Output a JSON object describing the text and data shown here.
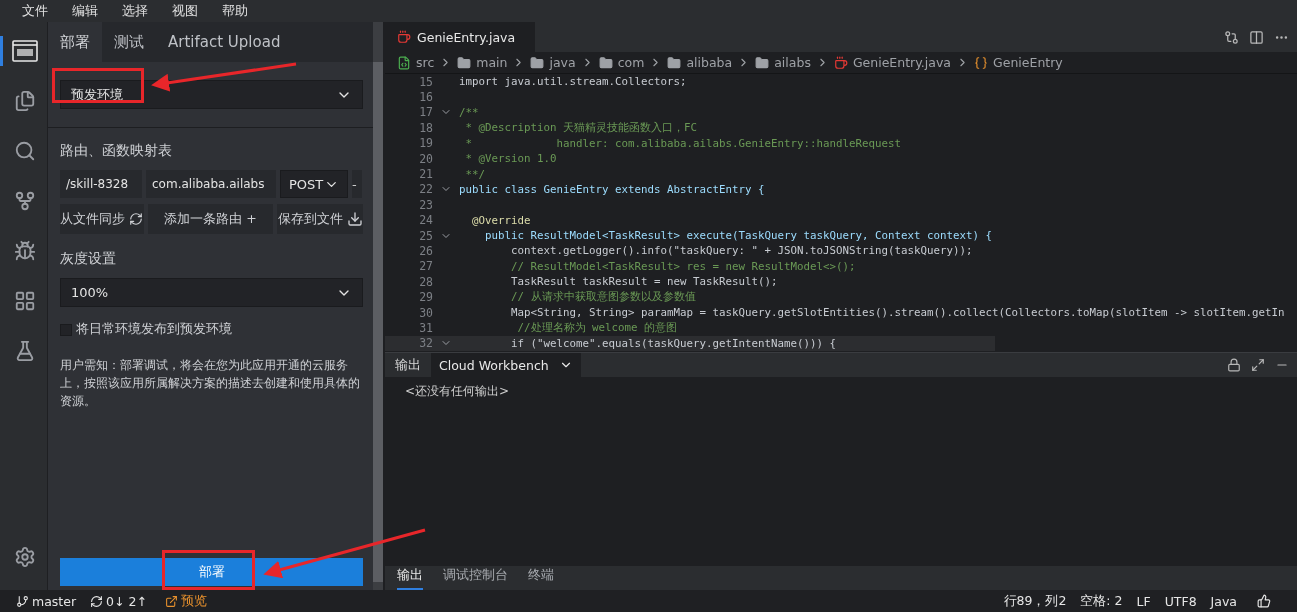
{
  "menu": [
    "文件",
    "编辑",
    "选择",
    "视图",
    "帮助"
  ],
  "activity_bar": [
    {
      "selected": true
    },
    {
      "selected": false
    },
    {
      "selected": false
    },
    {
      "selected": false
    },
    {
      "selected": false
    },
    {
      "selected": false
    },
    {
      "selected": false
    }
  ],
  "side_panel": {
    "tabs": [
      {
        "label": "部署",
        "selected": true
      },
      {
        "label": "测试",
        "selected": false
      },
      {
        "label": "Artifact Upload",
        "selected": false
      }
    ],
    "environment": {
      "value": "预发环境"
    },
    "routes": {
      "title": "路由、函数映射表",
      "path": "/skill-8328",
      "handler": "com.alibaba.ailabs",
      "method": "POST",
      "remove": "-",
      "buttons": [
        {
          "label": "从文件同步",
          "kind": "sync"
        },
        {
          "label": "添加一条路由 +",
          "kind": "plain"
        },
        {
          "label": "保存到文件",
          "kind": "download"
        }
      ]
    },
    "gray": {
      "title": "灰度设置",
      "value": "100%"
    },
    "checkbox": {
      "label": "将日常环境发布到预发环境",
      "checked": false
    },
    "notice": "用户需知：部署调试，将会在您为此应用开通的云服务上，按照该应用所属解决方案的描述去创建和使用具体的资源。",
    "deploy_button": "部署"
  },
  "editor": {
    "tab": "GenieEntry.java",
    "breadcrumbs": [
      {
        "label": "src",
        "kind": "source"
      },
      {
        "label": "main",
        "kind": "folder"
      },
      {
        "label": "java",
        "kind": "folder"
      },
      {
        "label": "com",
        "kind": "folder"
      },
      {
        "label": "alibaba",
        "kind": "folder"
      },
      {
        "label": "ailabs",
        "kind": "folder"
      },
      {
        "label": "GenieEntry.java",
        "kind": "file"
      },
      {
        "label": "GenieEntry",
        "kind": "class"
      }
    ],
    "lines": [
      {
        "number": "15",
        "foldable": false,
        "highlighted": false,
        "kind": "code",
        "text": "import java.util.stream.Collectors;"
      },
      {
        "number": "16",
        "foldable": false,
        "highlighted": false
      },
      {
        "number": "17",
        "foldable": true,
        "highlighted": false,
        "kind": "comment",
        "text": "/**"
      },
      {
        "number": "18",
        "foldable": false,
        "highlighted": false,
        "kind": "comment",
        "text": " * @Description 天猫精灵技能函数入口，FC"
      },
      {
        "number": "19",
        "foldable": false,
        "highlighted": false,
        "kind": "comment",
        "text": " *             handler: com.alibaba.ailabs.GenieEntry::handleRequest"
      },
      {
        "number": "20",
        "foldable": false,
        "highlighted": false,
        "kind": "comment",
        "text": " * @Version 1.0"
      },
      {
        "number": "21",
        "foldable": false,
        "highlighted": false,
        "kind": "comment",
        "text": " **/"
      },
      {
        "number": "22",
        "foldable": true,
        "highlighted": false,
        "kind": "declaration",
        "text": "public class GenieEntry extends AbstractEntry {"
      },
      {
        "number": "23",
        "foldable": false,
        "highlighted": false
      },
      {
        "number": "24",
        "foldable": false,
        "highlighted": false,
        "kind": "annotation",
        "text": "  @Override"
      },
      {
        "number": "25",
        "foldable": true,
        "highlighted": false,
        "kind": "declaration",
        "text": "    public ResultModel<TaskResult> execute(TaskQuery taskQuery, Context context) {"
      },
      {
        "number": "26",
        "foldable": false,
        "highlighted": false,
        "kind": "code",
        "text": "        context.getLogger().info(\"taskQuery: \" + JSON.toJSONString(taskQuery));"
      },
      {
        "number": "27",
        "foldable": false,
        "highlighted": false,
        "kind": "comment",
        "text": "        // ResultModel<TaskResult> res = new ResultModel<>();"
      },
      {
        "number": "28",
        "foldable": false,
        "highlighted": false,
        "kind": "code",
        "text": "        TaskResult taskResult = new TaskResult();"
      },
      {
        "number": "29",
        "foldable": false,
        "highlighted": false,
        "kind": "comment",
        "text": "        // 从请求中获取意图参数以及参数值"
      },
      {
        "number": "30",
        "foldable": false,
        "highlighted": false,
        "kind": "code",
        "text": "        Map<String, String> paramMap = taskQuery.getSlotEntities().stream().collect(Collectors.toMap(slotItem -> slotItem.getIn"
      },
      {
        "number": "31",
        "foldable": false,
        "highlighted": false,
        "kind": "comment",
        "text": "         //处理名称为 welcome 的意图"
      },
      {
        "number": "32",
        "foldable": true,
        "highlighted": true,
        "kind": "code",
        "text": "        if (\"welcome\".equals(taskQuery.getIntentName())) {"
      }
    ]
  },
  "output": {
    "title": "输出",
    "channel": "Cloud Workbench",
    "content": "<还没有任何输出>"
  },
  "bottom_tabs": [
    {
      "label": "输出",
      "selected": true
    },
    {
      "label": "调试控制台",
      "selected": false
    },
    {
      "label": "终端",
      "selected": false
    }
  ],
  "status_bar": {
    "branch": "master",
    "sync": "0↓ 2↑",
    "preview": "预览",
    "right": [
      "行89，列2",
      "空格: 2",
      "LF",
      "UTF8",
      "Java"
    ]
  }
}
